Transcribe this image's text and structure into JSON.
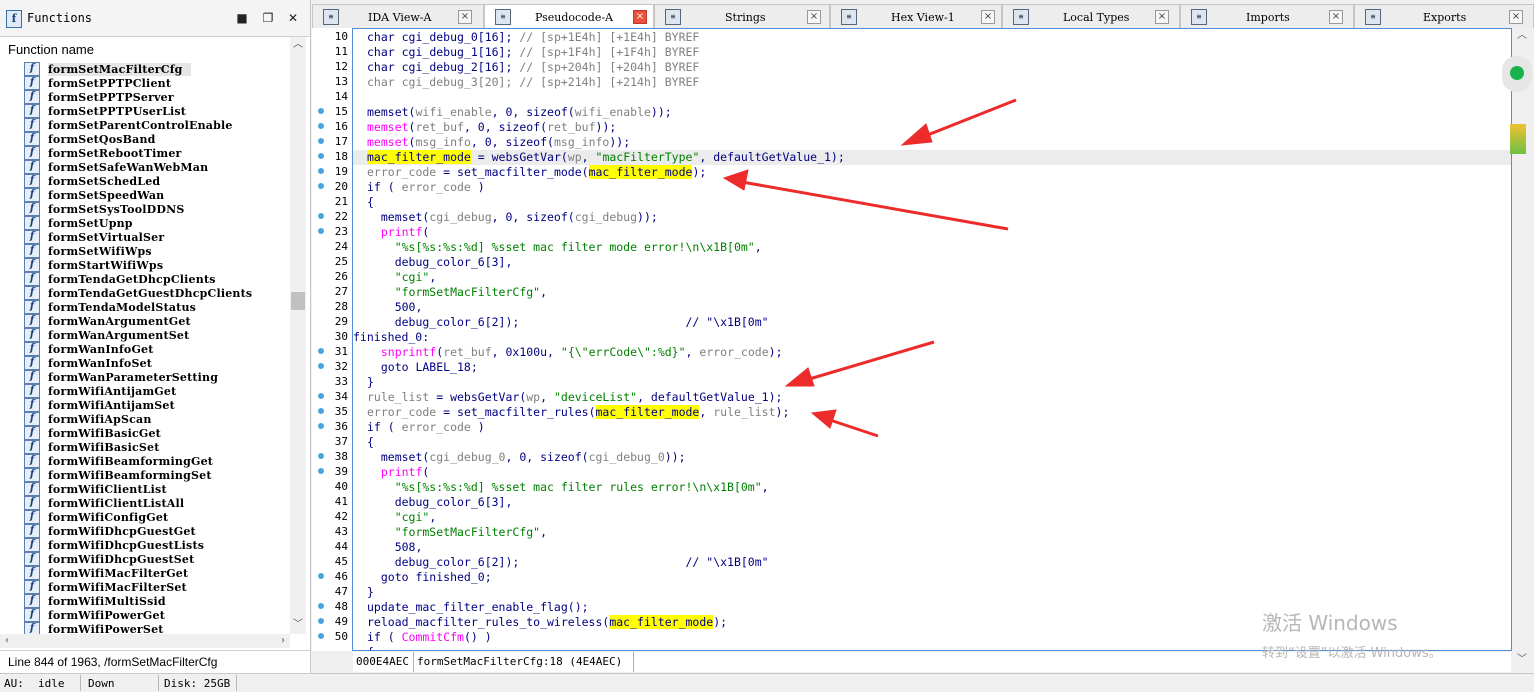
{
  "functions_panel": {
    "title": "Functions",
    "column_header": "Function name",
    "items": [
      {
        "name": "formSetMacFilterCfg",
        "selected": true
      },
      {
        "name": "formSetPPTPClient"
      },
      {
        "name": "formSetPPTPServer"
      },
      {
        "name": "formSetPPTPUserList"
      },
      {
        "name": "formSetParentControlEnable"
      },
      {
        "name": "formSetQosBand"
      },
      {
        "name": "formSetRebootTimer"
      },
      {
        "name": "formSetSafeWanWebMan"
      },
      {
        "name": "formSetSchedLed"
      },
      {
        "name": "formSetSpeedWan"
      },
      {
        "name": "formSetSysToolDDNS"
      },
      {
        "name": "formSetUpnp"
      },
      {
        "name": "formSetVirtualSer"
      },
      {
        "name": "formSetWifiWps"
      },
      {
        "name": "formStartWifiWps"
      },
      {
        "name": "formTendaGetDhcpClients"
      },
      {
        "name": "formTendaGetGuestDhcpClients"
      },
      {
        "name": "formTendaModelStatus"
      },
      {
        "name": "formWanArgumentGet"
      },
      {
        "name": "formWanArgumentSet"
      },
      {
        "name": "formWanInfoGet"
      },
      {
        "name": "formWanInfoSet"
      },
      {
        "name": "formWanParameterSetting"
      },
      {
        "name": "formWifiAntijamGet"
      },
      {
        "name": "formWifiAntijamSet"
      },
      {
        "name": "formWifiApScan"
      },
      {
        "name": "formWifiBasicGet"
      },
      {
        "name": "formWifiBasicSet"
      },
      {
        "name": "formWifiBeamformingGet"
      },
      {
        "name": "formWifiBeamformingSet"
      },
      {
        "name": "formWifiClientList"
      },
      {
        "name": "formWifiClientListAll"
      },
      {
        "name": "formWifiConfigGet"
      },
      {
        "name": "formWifiDhcpGuestGet"
      },
      {
        "name": "formWifiDhcpGuestLists"
      },
      {
        "name": "formWifiDhcpGuestSet"
      },
      {
        "name": "formWifiMacFilterGet"
      },
      {
        "name": "formWifiMacFilterSet"
      },
      {
        "name": "formWifiMultiSsid"
      },
      {
        "name": "formWifiPowerGet"
      },
      {
        "name": "formWifiPowerSet"
      }
    ],
    "line_status": "Line 844 of 1963, /formSetMacFilterCfg"
  },
  "tabs": [
    {
      "label": "IDA View-A",
      "icon": "ida-view-icon"
    },
    {
      "label": "Pseudocode-A",
      "icon": "pseudocode-icon",
      "active": true
    },
    {
      "label": "Strings",
      "icon": "strings-icon"
    },
    {
      "label": "Hex View-1",
      "icon": "hex-view-icon"
    },
    {
      "label": "Local Types",
      "icon": "local-types-icon"
    },
    {
      "label": "Imports",
      "icon": "imports-icon"
    },
    {
      "label": "Exports",
      "icon": "exports-icon"
    }
  ],
  "code": {
    "lines": [
      {
        "n": "10",
        "dot": false,
        "t": [
          [
            "kw",
            "char "
          ],
          [
            "nv",
            "cgi_debug_0[16]; "
          ],
          [
            "cm",
            "// [sp+1E4h] [+1E4h] BYREF"
          ]
        ]
      },
      {
        "n": "11",
        "dot": false,
        "t": [
          [
            "kw",
            "char "
          ],
          [
            "nv",
            "cgi_debug_1[16]; "
          ],
          [
            "cm",
            "// [sp+1F4h] [+1F4h] BYREF"
          ]
        ]
      },
      {
        "n": "12",
        "dot": false,
        "t": [
          [
            "kw",
            "char "
          ],
          [
            "nv",
            "cgi_debug_2[16]; "
          ],
          [
            "cm",
            "// [sp+204h] [+204h] BYREF"
          ]
        ]
      },
      {
        "n": "13",
        "dot": false,
        "t": [
          [
            "gv",
            "char cgi_debug_3[20]; "
          ],
          [
            "cm",
            "// [sp+214h] [+214h] BYREF"
          ]
        ]
      },
      {
        "n": "14",
        "dot": false,
        "t": []
      },
      {
        "n": "15",
        "dot": true,
        "t": [
          [
            "pl",
            "memset("
          ],
          [
            "gv",
            "wifi_enable"
          ],
          [
            "pl",
            ", 0, sizeof("
          ],
          [
            "gv",
            "wifi_enable"
          ],
          [
            "pl",
            "));"
          ]
        ]
      },
      {
        "n": "16",
        "dot": true,
        "t": [
          [
            "fn",
            "memset"
          ],
          [
            "pl",
            "("
          ],
          [
            "gv",
            "ret_buf"
          ],
          [
            "pl",
            ", 0, sizeof("
          ],
          [
            "gv",
            "ret_buf"
          ],
          [
            "pl",
            "));"
          ]
        ]
      },
      {
        "n": "17",
        "dot": true,
        "t": [
          [
            "fn",
            "memset"
          ],
          [
            "pl",
            "("
          ],
          [
            "gv",
            "msg_info"
          ],
          [
            "pl",
            ", 0, sizeof("
          ],
          [
            "gv",
            "msg_info"
          ],
          [
            "pl",
            "));"
          ]
        ]
      },
      {
        "n": "18",
        "dot": true,
        "cur": true,
        "t": [
          [
            "hl",
            "mac_filter_mode"
          ],
          [
            "pl",
            " = websGetVar("
          ],
          [
            "gv",
            "wp"
          ],
          [
            "pl",
            ", "
          ],
          [
            "st",
            "\"macFilterType\""
          ],
          [
            "pl",
            ", defaultGetValue_1);"
          ]
        ]
      },
      {
        "n": "19",
        "dot": true,
        "t": [
          [
            "gv",
            "error_code"
          ],
          [
            "pl",
            " = set_macfilter_mode("
          ],
          [
            "hl",
            "mac_filter_mode"
          ],
          [
            "pl",
            ");"
          ]
        ]
      },
      {
        "n": "20",
        "dot": true,
        "t": [
          [
            "kw",
            "if ( "
          ],
          [
            "gv",
            "error_code"
          ],
          [
            "kw",
            " )"
          ]
        ]
      },
      {
        "n": "21",
        "dot": false,
        "t": [
          [
            "pl",
            "{"
          ]
        ]
      },
      {
        "n": "22",
        "dot": true,
        "t": [
          [
            "pl",
            "  memset("
          ],
          [
            "gv",
            "cgi_debug"
          ],
          [
            "pl",
            ", 0, sizeof("
          ],
          [
            "gv",
            "cgi_debug"
          ],
          [
            "pl",
            "));"
          ]
        ]
      },
      {
        "n": "23",
        "dot": true,
        "t": [
          [
            "fn",
            "  printf"
          ],
          [
            "pl",
            "("
          ]
        ]
      },
      {
        "n": "24",
        "dot": false,
        "t": [
          [
            "st",
            "    \"%s[%s:%s:%d] %sset mac filter mode error!\\n\\x1B[0m\""
          ],
          [
            "pl",
            ","
          ]
        ]
      },
      {
        "n": "25",
        "dot": false,
        "t": [
          [
            "pl",
            "    debug_color_6[3],"
          ]
        ]
      },
      {
        "n": "26",
        "dot": false,
        "t": [
          [
            "st",
            "    \"cgi\""
          ],
          [
            "pl",
            ","
          ]
        ]
      },
      {
        "n": "27",
        "dot": false,
        "t": [
          [
            "st",
            "    \"formSetMacFilterCfg\""
          ],
          [
            "pl",
            ","
          ]
        ]
      },
      {
        "n": "28",
        "dot": false,
        "t": [
          [
            "pl",
            "    500,"
          ]
        ]
      },
      {
        "n": "29",
        "dot": false,
        "t": [
          [
            "pl",
            "    debug_color_6[2]);                        "
          ],
          [
            "pl",
            "// \"\\x1B[0m\""
          ]
        ]
      },
      {
        "n": "30",
        "dot": false,
        "lbl": true,
        "t": [
          [
            "lbl",
            "finished_0:"
          ]
        ]
      },
      {
        "n": "31",
        "dot": true,
        "t": [
          [
            "fn",
            "  snprintf"
          ],
          [
            "pl",
            "("
          ],
          [
            "gv",
            "ret_buf"
          ],
          [
            "pl",
            ", 0x100u, "
          ],
          [
            "st",
            "\"{\\\"errCode\\\":%d}\""
          ],
          [
            "pl",
            ", "
          ],
          [
            "gv",
            "error_code"
          ],
          [
            "pl",
            ");"
          ]
        ]
      },
      {
        "n": "32",
        "dot": true,
        "t": [
          [
            "pl",
            "  goto LABEL_18;"
          ]
        ]
      },
      {
        "n": "33",
        "dot": false,
        "t": [
          [
            "pl",
            "}"
          ]
        ]
      },
      {
        "n": "34",
        "dot": true,
        "t": [
          [
            "gv",
            "rule_list"
          ],
          [
            "pl",
            " = websGetVar("
          ],
          [
            "gv",
            "wp"
          ],
          [
            "pl",
            ", "
          ],
          [
            "st",
            "\"deviceList\""
          ],
          [
            "pl",
            ", defaultGetValue_1);"
          ]
        ]
      },
      {
        "n": "35",
        "dot": true,
        "t": [
          [
            "gv",
            "error_code"
          ],
          [
            "pl",
            " = set_macfilter_rules("
          ],
          [
            "hl",
            "mac_filter_mode"
          ],
          [
            "pl",
            ", "
          ],
          [
            "gv",
            "rule_list"
          ],
          [
            "pl",
            ");"
          ]
        ]
      },
      {
        "n": "36",
        "dot": true,
        "t": [
          [
            "kw",
            "if ( "
          ],
          [
            "gv",
            "error_code"
          ],
          [
            "kw",
            " )"
          ]
        ]
      },
      {
        "n": "37",
        "dot": false,
        "t": [
          [
            "pl",
            "{"
          ]
        ]
      },
      {
        "n": "38",
        "dot": true,
        "t": [
          [
            "pl",
            "  memset("
          ],
          [
            "gv",
            "cgi_debug_0"
          ],
          [
            "pl",
            ", 0, sizeof("
          ],
          [
            "gv",
            "cgi_debug_0"
          ],
          [
            "pl",
            "));"
          ]
        ]
      },
      {
        "n": "39",
        "dot": true,
        "t": [
          [
            "fn",
            "  printf"
          ],
          [
            "pl",
            "("
          ]
        ]
      },
      {
        "n": "40",
        "dot": false,
        "t": [
          [
            "st",
            "    \"%s[%s:%s:%d] %sset mac filter rules error!\\n\\x1B[0m\""
          ],
          [
            "pl",
            ","
          ]
        ]
      },
      {
        "n": "41",
        "dot": false,
        "t": [
          [
            "pl",
            "    debug_color_6[3],"
          ]
        ]
      },
      {
        "n": "42",
        "dot": false,
        "t": [
          [
            "st",
            "    \"cgi\""
          ],
          [
            "pl",
            ","
          ]
        ]
      },
      {
        "n": "43",
        "dot": false,
        "t": [
          [
            "st",
            "    \"formSetMacFilterCfg\""
          ],
          [
            "pl",
            ","
          ]
        ]
      },
      {
        "n": "44",
        "dot": false,
        "t": [
          [
            "pl",
            "    508,"
          ]
        ]
      },
      {
        "n": "45",
        "dot": false,
        "t": [
          [
            "pl",
            "    debug_color_6[2]);                        "
          ],
          [
            "pl",
            "// \"\\x1B[0m\""
          ]
        ]
      },
      {
        "n": "46",
        "dot": true,
        "t": [
          [
            "pl",
            "  goto finished_0;"
          ]
        ]
      },
      {
        "n": "47",
        "dot": false,
        "t": [
          [
            "pl",
            "}"
          ]
        ]
      },
      {
        "n": "48",
        "dot": true,
        "t": [
          [
            "pl",
            "update_mac_filter_enable_flag();"
          ]
        ]
      },
      {
        "n": "49",
        "dot": true,
        "t": [
          [
            "pl",
            "reload_macfilter_rules_to_wireless("
          ],
          [
            "hl",
            "mac_filter_mode"
          ],
          [
            "pl",
            ");"
          ]
        ]
      },
      {
        "n": "50",
        "dot": true,
        "t": [
          [
            "kw",
            "if ( "
          ],
          [
            "fn",
            "CommitCfm"
          ],
          [
            "pl",
            "() )"
          ]
        ]
      },
      {
        "n": "",
        "dot": false,
        "t": [
          [
            "pl",
            "{"
          ]
        ]
      }
    ]
  },
  "address_bar": {
    "address": "000E4AEC",
    "location": "formSetMacFilterCfg:18 (4E4AEC)"
  },
  "status": {
    "au_label": "AU:",
    "au_value": "idle",
    "direction": "Down",
    "disk": "Disk: 25GB"
  },
  "watermark": {
    "line1": "激活 Windows",
    "line2": "转到“设置”以激活 Windows。"
  },
  "colors": {
    "arrow": "#ee2b2b",
    "highlight": "#ffff00",
    "tab_close_active": "#e8513c",
    "breakpoint_dot": "#4aa3df"
  }
}
